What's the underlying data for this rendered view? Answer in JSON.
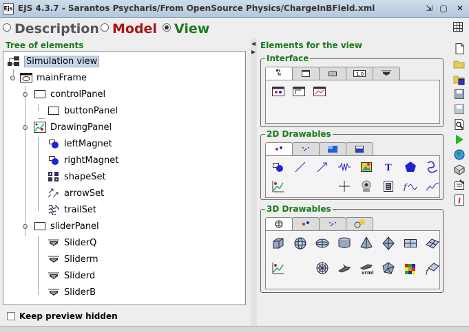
{
  "window": {
    "app_icon_text": "Ejs",
    "title": "EJS 4.3.7 - Sarantos Psycharis/From OpenSource Physics/ChargeInBField.xml",
    "buttons": [
      "restore-icon",
      "maximize-icon",
      "close-icon"
    ]
  },
  "modes": [
    {
      "label": "Description",
      "color": "#555555",
      "selected": false
    },
    {
      "label": "Model",
      "color": "#aa1111",
      "selected": false
    },
    {
      "label": "View",
      "color": "#1a7a1a",
      "selected": true
    }
  ],
  "tree": {
    "heading": "Tree of elements",
    "items": [
      {
        "label": "Simulation view",
        "icon": "simulation-view-icon",
        "level": 0,
        "selected": true
      },
      {
        "label": "mainFrame",
        "icon": "frame-icon",
        "level": 1
      },
      {
        "label": "controlPanel",
        "icon": "panel-icon",
        "level": 2
      },
      {
        "label": "buttonPanel",
        "icon": "panel-icon",
        "level": 3
      },
      {
        "label": "DrawingPanel",
        "icon": "drawing-panel-icon",
        "level": 2
      },
      {
        "label": "leftMagnet",
        "icon": "particle-icon",
        "level": 3
      },
      {
        "label": "rightMagnet",
        "icon": "particle-icon",
        "level": 3
      },
      {
        "label": "shapeSet",
        "icon": "shape-set-icon",
        "level": 3
      },
      {
        "label": "arrowSet",
        "icon": "arrow-set-icon",
        "level": 3
      },
      {
        "label": "trailSet",
        "icon": "trail-set-icon",
        "level": 3
      },
      {
        "label": "sliderPanel",
        "icon": "panel-icon",
        "level": 2
      },
      {
        "label": "SliderQ",
        "icon": "slider-icon",
        "level": 3
      },
      {
        "label": "Sliderm",
        "icon": "slider-icon",
        "level": 3
      },
      {
        "label": "Sliderd",
        "icon": "slider-icon",
        "level": 3
      },
      {
        "label": "SliderB",
        "icon": "slider-icon",
        "level": 3
      }
    ],
    "keep_preview_label": "Keep preview hidden"
  },
  "elements": {
    "heading": "Elements for the view",
    "groups": [
      {
        "title": "Interface",
        "tabs": 5,
        "active_tab": 0,
        "icon_count": 3
      },
      {
        "title": "2D Drawables",
        "tabs": 4,
        "active_tab": 0,
        "icon_count": 16
      },
      {
        "title": "3D Drawables",
        "tabs": 4,
        "active_tab": 0,
        "icon_count": 16
      }
    ],
    "interface_tab_labels": [
      "",
      "",
      "",
      "1.0",
      ""
    ]
  },
  "toolbar": {
    "tools": [
      "new-icon",
      "open-icon",
      "open-examples-icon",
      "save-icon",
      "save-as-icon",
      "search-icon",
      "run-icon",
      "translate-icon",
      "package-icon",
      "options-icon",
      "info-icon"
    ]
  }
}
